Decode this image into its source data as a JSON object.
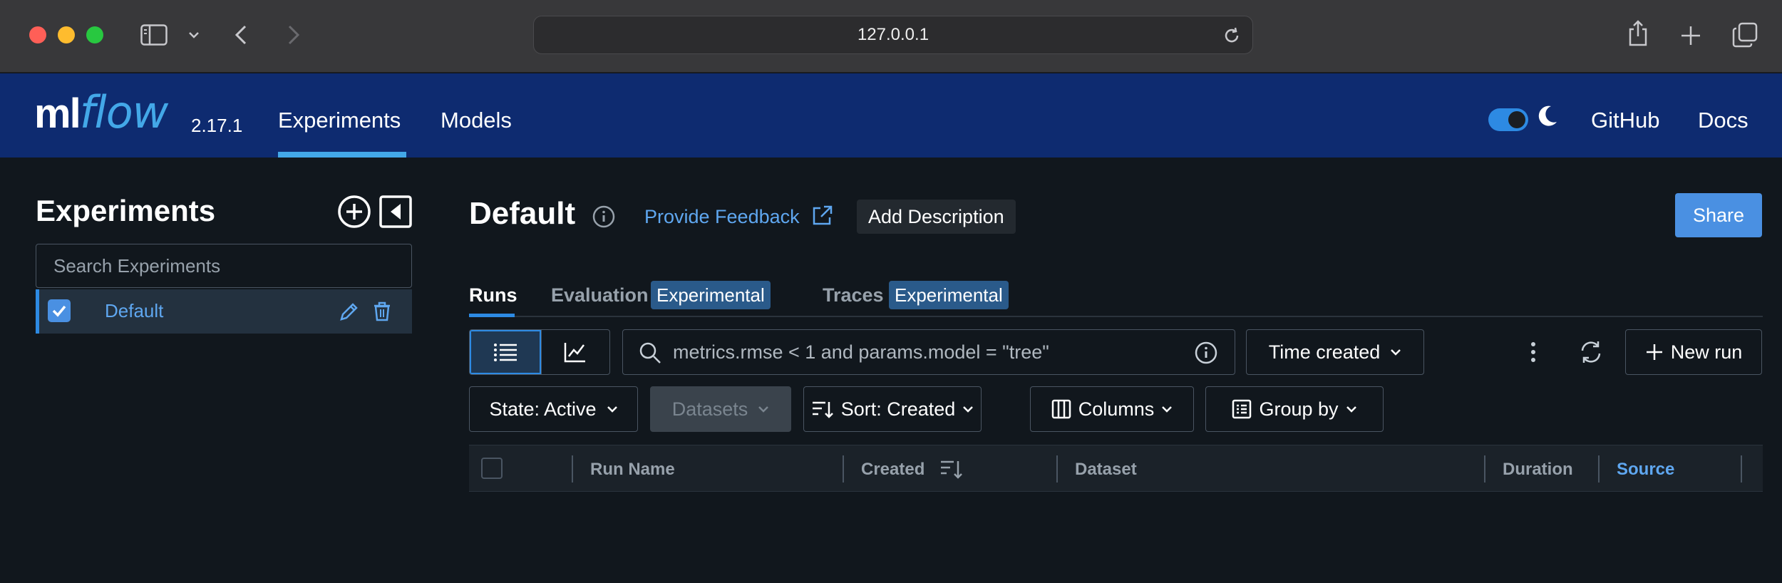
{
  "browser": {
    "url": "127.0.0.1"
  },
  "header": {
    "logo_ml": "ml",
    "logo_flow": "flow",
    "version": "2.17.1",
    "nav": [
      "Experiments",
      "Models"
    ],
    "right_links": [
      "GitHub",
      "Docs"
    ],
    "accent": "#43a8e8",
    "background": "#0e2b70"
  },
  "sidebar": {
    "title": "Experiments",
    "search_placeholder": "Search Experiments",
    "experiments": [
      {
        "name": "Default",
        "checked": true
      }
    ]
  },
  "main": {
    "title": "Default",
    "feedback_link": "Provide Feedback",
    "add_description": "Add Description",
    "share": "Share",
    "tabs": [
      {
        "label": "Runs",
        "active": true
      },
      {
        "label": "Evaluation",
        "badge": "Experimental"
      },
      {
        "label": "Traces",
        "badge": "Experimental"
      }
    ],
    "filter_placeholder": "metrics.rmse < 1 and params.model = \"tree\"",
    "time_select": "Time created",
    "new_run": "New run",
    "state_filter": "State: Active",
    "datasets": "Datasets",
    "sort": "Sort: Created",
    "columns": "Columns",
    "group_by": "Group by",
    "table_columns": [
      "Run Name",
      "Created",
      "Dataset",
      "Duration",
      "Source"
    ]
  },
  "colors": {
    "primary_button": "#4a90e2",
    "link": "#5fa7f0",
    "badge": "#2a5a8a"
  }
}
